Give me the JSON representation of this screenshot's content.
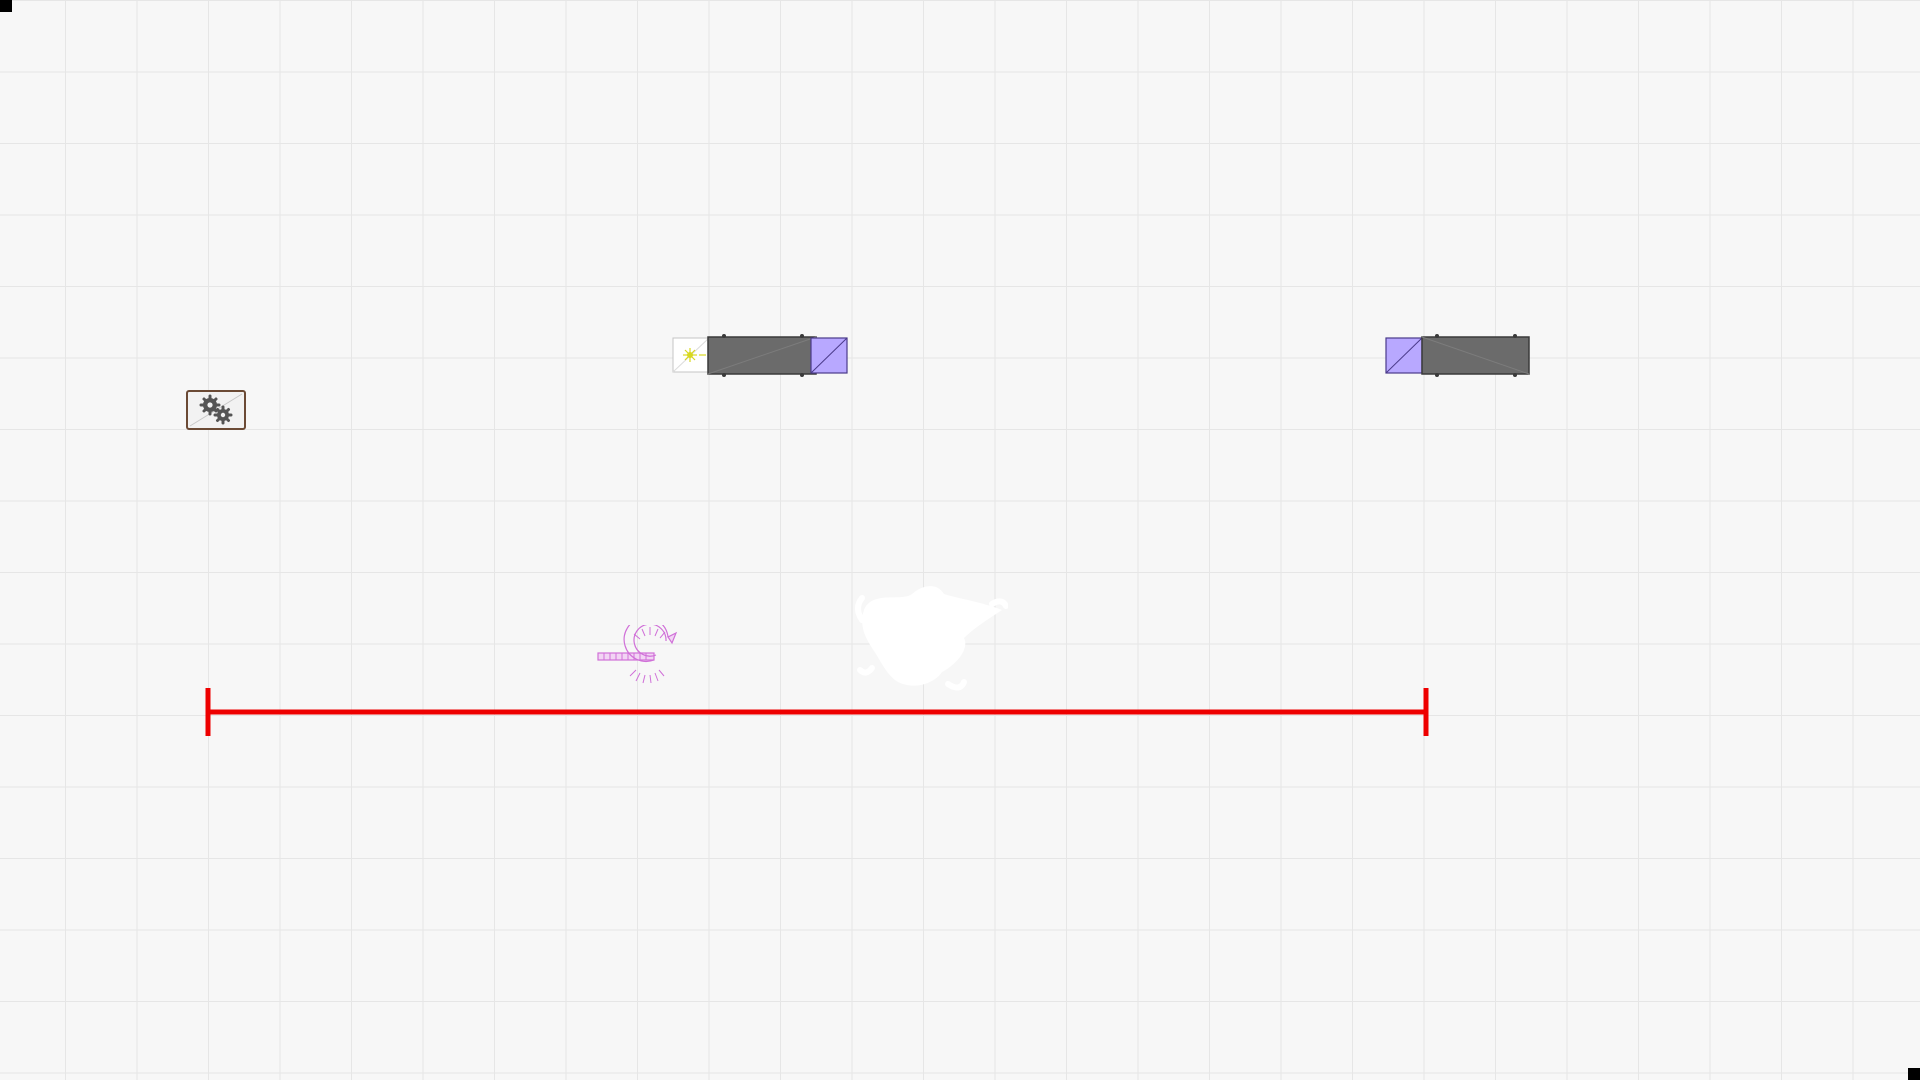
{
  "canvas": {
    "background_color": "#f7f7f7",
    "grid_color": "#e6e6e6",
    "grid": true
  },
  "objects": {
    "settings_box": {
      "icon": "gears-icon",
      "border_color": "#6b4a35"
    },
    "truck_left": {
      "icon": "truck-icon",
      "light_icon": "sun-icon",
      "cab_color": "#b8a8ff",
      "body_color": "#6b6b6b"
    },
    "truck_right": {
      "icon": "truck-icon",
      "cab_color": "#b8a8ff",
      "body_color": "#6b6b6b"
    },
    "measure_line": {
      "icon": "ruler-icon",
      "color": "#ee0000"
    },
    "spiral_item": {
      "icon": "spring-icon",
      "color": "#d070d8"
    },
    "white_blob": {
      "icon": "smudge-icon",
      "color": "#ffffff"
    }
  }
}
